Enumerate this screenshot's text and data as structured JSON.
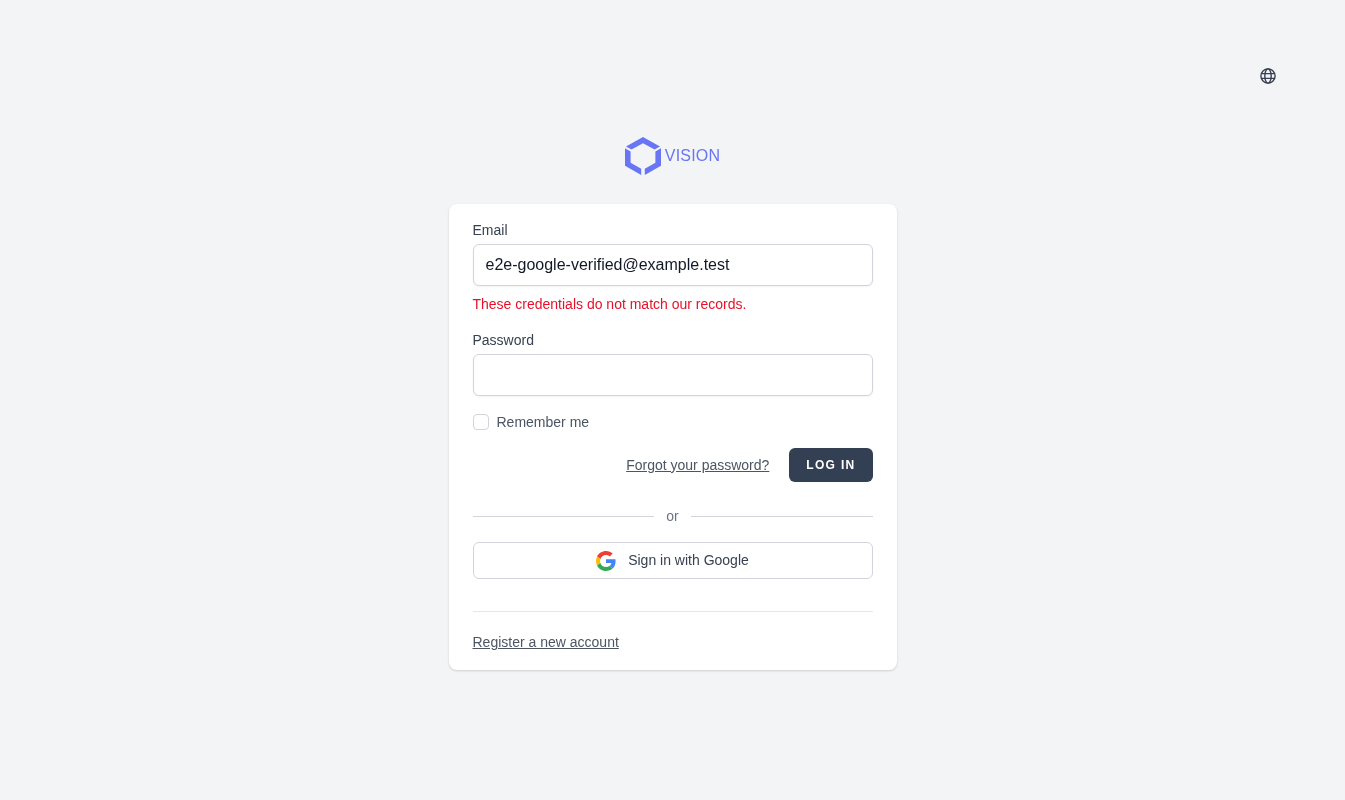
{
  "logo": {
    "text": "VISION"
  },
  "fields": [
    {
      "label": "Email",
      "value": "e2e-google-verified@example.test",
      "error": "These credentials do not match our records."
    },
    {
      "label": "Password"
    }
  ],
  "remember": {
    "label": "Remember me",
    "checked": false
  },
  "forgot_link": "Forgot your password?",
  "submit_button": "LOG IN",
  "divider": "or",
  "google_button": "Sign in with Google",
  "register_link": "Register a new account"
}
